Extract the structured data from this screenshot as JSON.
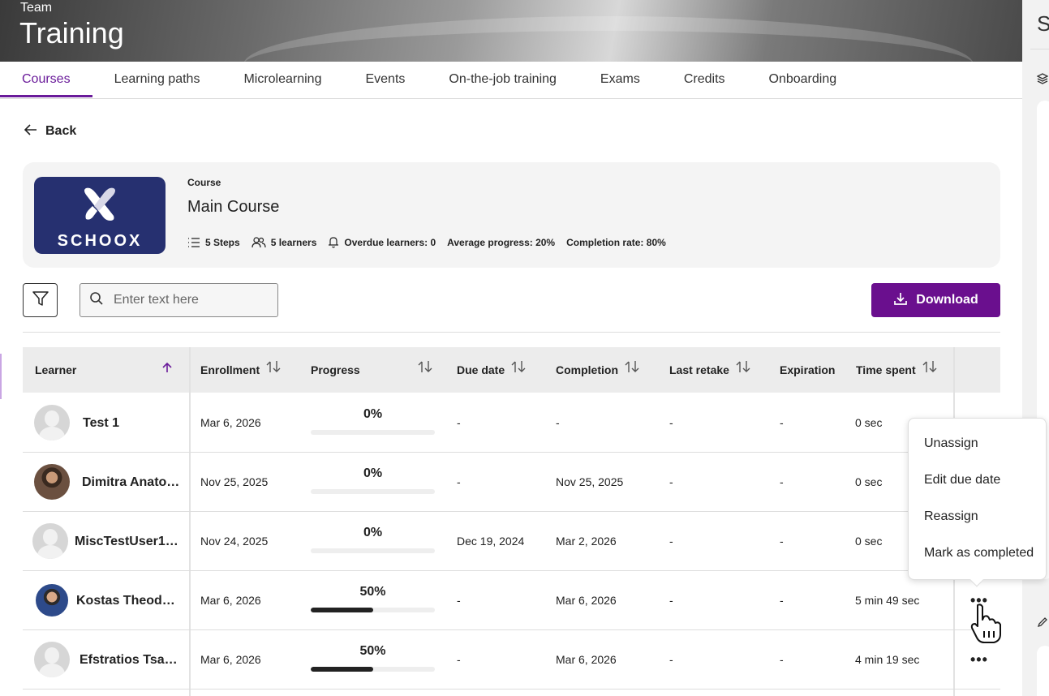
{
  "header": {
    "team_label": "Team",
    "title": "Training"
  },
  "tabs": [
    {
      "label": "Courses",
      "active": true
    },
    {
      "label": "Learning paths"
    },
    {
      "label": "Microlearning"
    },
    {
      "label": "Events"
    },
    {
      "label": "On-the-job training"
    },
    {
      "label": "Exams"
    },
    {
      "label": "Credits"
    },
    {
      "label": "Onboarding"
    }
  ],
  "right_panel": {
    "initial": "S"
  },
  "back_label": "Back",
  "course": {
    "type_label": "Course",
    "name": "Main Course",
    "logo_text": "SCHOOX",
    "stats": {
      "steps": "5 Steps",
      "learners": "5 learners",
      "overdue": "Overdue learners: 0",
      "avg_progress": "Average progress: 20%",
      "completion_rate": "Completion rate: 80%"
    }
  },
  "search": {
    "placeholder": "Enter text here",
    "value": ""
  },
  "download_label": "Download",
  "colors": {
    "accent": "#6a0f8e",
    "logo_bg": "#263070"
  },
  "table": {
    "headers": {
      "learner": "Learner",
      "enrollment": "Enrollment",
      "progress": "Progress",
      "due_date": "Due date",
      "completion": "Completion",
      "last_retake": "Last retake",
      "expiration": "Expiration",
      "time_spent": "Time spent"
    },
    "rows": [
      {
        "name": "Test 1",
        "enrollment": "Mar 6, 2026",
        "progress_text": "0%",
        "progress": 0,
        "due_date": "-",
        "completion": "-",
        "last_retake": "-",
        "expiration": "-",
        "time_spent": "0 sec",
        "avatar": "placeholder"
      },
      {
        "name": "Dimitra Anato…",
        "enrollment": "Nov 25, 2025",
        "progress_text": "0%",
        "progress": 0,
        "due_date": "-",
        "completion": "Nov 25, 2025",
        "last_retake": "-",
        "expiration": "-",
        "time_spent": "0 sec",
        "avatar": "photo"
      },
      {
        "name": "MiscTestUser1…",
        "enrollment": "Nov 24, 2025",
        "progress_text": "0%",
        "progress": 0,
        "due_date": "Dec 19, 2024",
        "completion": "Mar 2, 2026",
        "last_retake": "-",
        "expiration": "-",
        "time_spent": "0 sec",
        "avatar": "placeholder"
      },
      {
        "name": "Kostas Theod…",
        "enrollment": "Mar 6, 2026",
        "progress_text": "50%",
        "progress": 0.5,
        "due_date": "-",
        "completion": "Mar 6, 2026",
        "last_retake": "-",
        "expiration": "-",
        "time_spent": "5 min 49 sec",
        "avatar": "photo"
      },
      {
        "name": "Efstratios Tsa…",
        "enrollment": "Mar 6, 2026",
        "progress_text": "50%",
        "progress": 0.5,
        "due_date": "-",
        "completion": "Mar 6, 2026",
        "last_retake": "-",
        "expiration": "-",
        "time_spent": "4 min 19 sec",
        "avatar": "placeholder"
      }
    ],
    "row_menu_icon": "more-dots-icon"
  },
  "context_menu": {
    "items": [
      "Unassign",
      "Edit due date",
      "Reassign",
      "Mark as completed"
    ]
  }
}
